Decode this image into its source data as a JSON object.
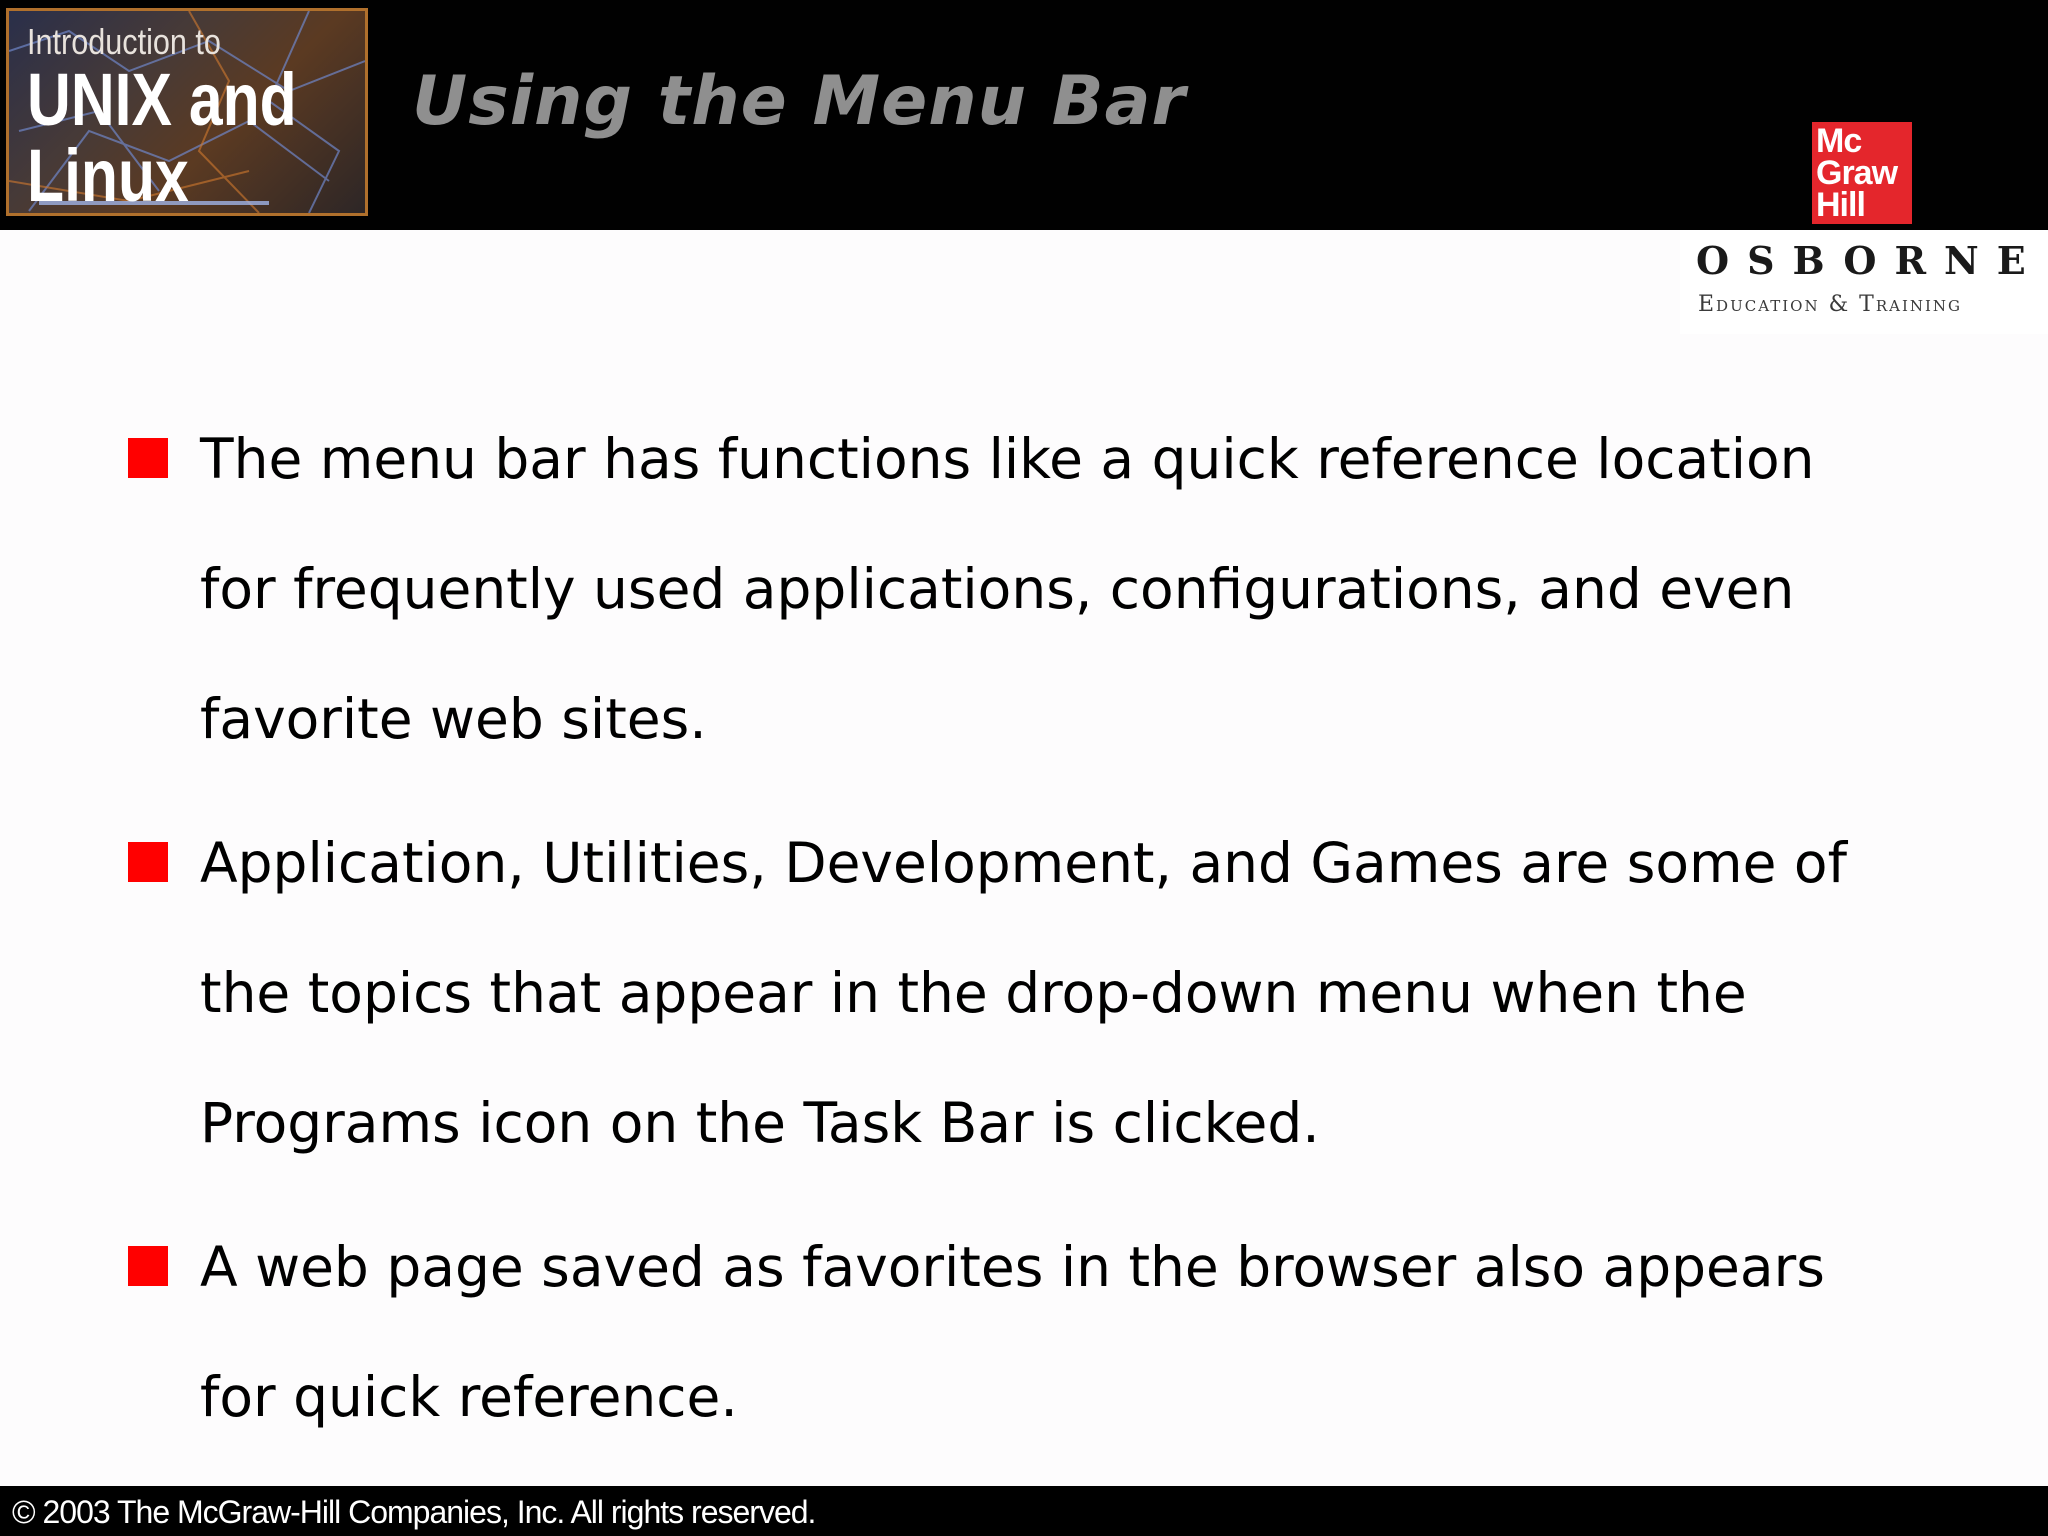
{
  "header": {
    "book_logo": {
      "line1": "Introduction to",
      "line2": "UNIX and",
      "line3": "Linux"
    },
    "title": "Using the Menu Bar"
  },
  "publisher": {
    "badge_lines": [
      "Mc",
      "Graw",
      "Hill"
    ],
    "imprint_name": "OSBORNE",
    "imprint_tagline": "Education & Training"
  },
  "bullets": [
    {
      "lines": [
        "The menu bar has functions like a quick reference location",
        "for frequently used applications, configurations, and even",
        "favorite web sites."
      ]
    },
    {
      "lines": [
        "Application, Utilities, Development, and Games are some of",
        "the topics that appear in the drop-down menu when the",
        "Programs icon on the Task Bar is clicked."
      ]
    },
    {
      "lines": [
        "A web page saved as favorites in the browser also appears",
        "for quick reference."
      ]
    }
  ],
  "footer": {
    "copyright": "© 2003 The McGraw-Hill Companies, Inc. All rights reserved."
  },
  "colors": {
    "header_background": "#010101",
    "bullet_marker": "#ff0000",
    "title_text": "#8f8f8f",
    "badge_red": "#e4262c",
    "logo_border": "#b0702c"
  }
}
